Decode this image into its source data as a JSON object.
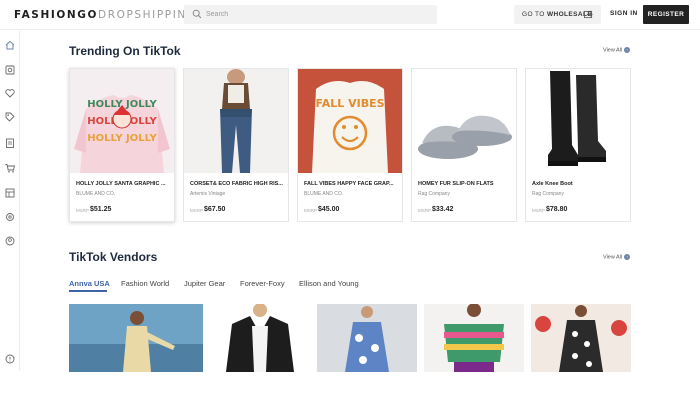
{
  "header": {
    "logo_part1": "FASHIONGO",
    "logo_part2": "DROPSHIPPING",
    "search_placeholder": "Search",
    "goto_prefix": "GO TO",
    "goto_bold": "WHOLESALE",
    "signin": "SIGN IN",
    "register": "REGISTER"
  },
  "sidebar": {
    "items": [
      "home-icon",
      "search-store-icon",
      "heart-icon",
      "tag-icon",
      "clipboard-icon",
      "cart-icon",
      "layout-icon",
      "settings-icon",
      "user-icon",
      "help-icon"
    ]
  },
  "trending": {
    "title": "Trending On TikTok",
    "view_all": "View All",
    "products": [
      {
        "name": "HOLLY JOLLY SANTA GRAPHIC ...",
        "vendor": "BLUME AND CO.",
        "msrp": "MSRP",
        "price": "$51.25"
      },
      {
        "name": "CORSET& ECO FABRIC HIGH RIS...",
        "vendor": "Artemis Vintage",
        "msrp": "MSRP",
        "price": "$67.50"
      },
      {
        "name": "FALL VIBES HAPPY FACE GRAP...",
        "vendor": "BLUME AND CO.",
        "msrp": "MSRP",
        "price": "$45.00"
      },
      {
        "name": "HOMEY FUR SLIP-ON FLATS",
        "vendor": "Rag Company",
        "msrp": "MSRP",
        "price": "$33.42"
      },
      {
        "name": "Axle Knee Boot",
        "vendor": "Rag Company",
        "msrp": "MSRP",
        "price": "$78.80"
      }
    ],
    "image_text": {
      "holly": [
        "HOLLY JOLLY",
        "HOLLY JOLLY",
        "HOLLY JOLLY"
      ],
      "fall": "FALL VIBES"
    }
  },
  "vendors": {
    "title": "TikTok Vendors",
    "view_all": "View All",
    "tabs": [
      "Annva USA",
      "Fashion World",
      "Jupiter Gear",
      "Forever-Foxy",
      "Ellison and Young"
    ]
  },
  "colors": {
    "accent": "#3e64a8",
    "dark": "#222222",
    "title": "#1e2a3b"
  }
}
